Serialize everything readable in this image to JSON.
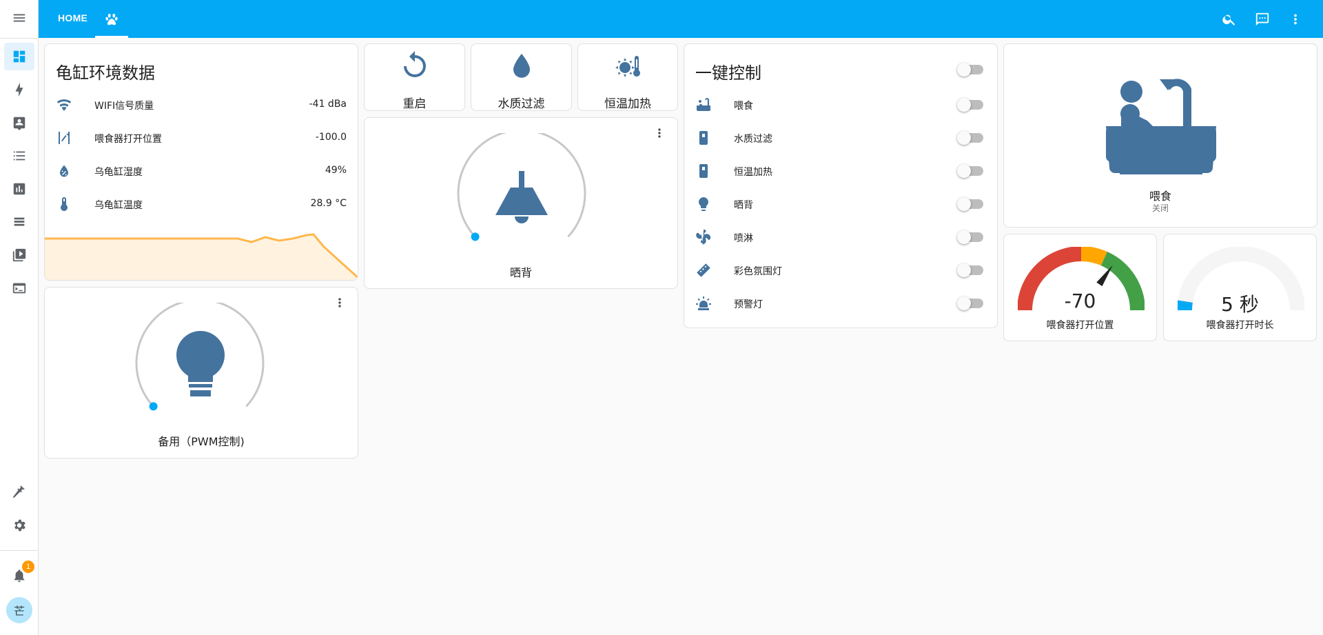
{
  "header": {
    "tabs": [
      {
        "label": "HOME"
      },
      {
        "icon": "paw-icon"
      }
    ],
    "actions": [
      "search-icon",
      "assist-icon",
      "more-vert-icon"
    ]
  },
  "sidebar": {
    "items": [
      {
        "icon": "dashboard-icon",
        "active": true
      },
      {
        "icon": "energy-icon"
      },
      {
        "icon": "map-icon"
      },
      {
        "icon": "logbook-icon"
      },
      {
        "icon": "history-icon"
      },
      {
        "icon": "hacs-icon"
      },
      {
        "icon": "media-icon"
      },
      {
        "icon": "terminal-icon"
      },
      {
        "icon": "developer-tools-icon"
      },
      {
        "icon": "settings-icon"
      }
    ],
    "notifications_count": "1",
    "user_initial": "芒"
  },
  "env_card": {
    "title": "龟缸环境数据",
    "rows": [
      {
        "icon": "wifi-icon",
        "name": "WIFI信号质量",
        "value": "-41 dBa"
      },
      {
        "icon": "servo-icon",
        "name": "喂食器打开位置",
        "value": "-100.0"
      },
      {
        "icon": "water-percent-icon",
        "name": "乌龟缸湿度",
        "value": "49%"
      },
      {
        "icon": "thermometer-icon",
        "name": "乌龟缸温度",
        "value": "28.9 °C"
      }
    ],
    "graph_color": "#ffb74d"
  },
  "buttons": [
    {
      "icon": "restart-icon",
      "label": "重启"
    },
    {
      "icon": "water-icon",
      "label": "水质过滤"
    },
    {
      "icon": "sun-thermometer-icon",
      "label": "恒温加热"
    }
  ],
  "light_bask": {
    "label": "晒背",
    "icon": "ceiling-lamp-icon"
  },
  "light_spare": {
    "label": "备用（PWM控制)",
    "icon": "lightbulb-icon"
  },
  "control_card": {
    "title": "一键控制",
    "rows": [
      {
        "icon": "bathtub-icon",
        "name": "喂食",
        "state": "off"
      },
      {
        "icon": "switch-box-icon",
        "name": "水质过滤",
        "state": "off"
      },
      {
        "icon": "switch-box-icon",
        "name": "恒温加热",
        "state": "off"
      },
      {
        "icon": "bulb-icon",
        "name": "晒背",
        "state": "off"
      },
      {
        "icon": "fan-icon",
        "name": "喷淋",
        "state": "off"
      },
      {
        "icon": "led-strip-icon",
        "name": "彩色氛围灯",
        "state": "off"
      },
      {
        "icon": "alarm-light-icon",
        "name": "预警灯",
        "state": "off"
      }
    ]
  },
  "feed_card": {
    "icon": "bathtub-icon",
    "name": "喂食",
    "state": "关闭"
  },
  "gauge_position": {
    "value": "-70",
    "label": "喂食器打开位置",
    "min": -180,
    "max": 180,
    "value_num": -70
  },
  "gauge_duration": {
    "value": "5 秒",
    "label": "喂食器打开时长",
    "fill_fraction": 0.05
  },
  "colors": {
    "primary": "#03a9f4",
    "icon": "#44739e",
    "gauge_red": "#db4437",
    "gauge_orange": "#ffa600",
    "gauge_green": "#43a047"
  }
}
